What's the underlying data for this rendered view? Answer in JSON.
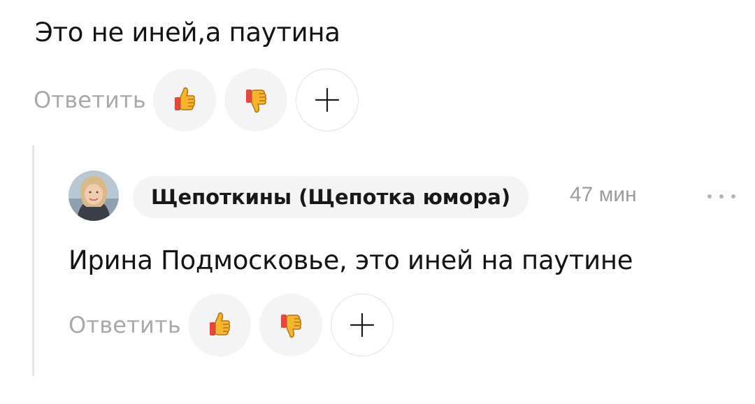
{
  "parent_comment": {
    "text": "Это не иней,а паутина",
    "reply_label": "Ответить",
    "like_icon": "thumbs-up-icon",
    "dislike_icon": "thumbs-down-icon",
    "add_reaction_icon": "plus-icon"
  },
  "reply_comment": {
    "author": "Щепоткины (Щепотка юмора)",
    "time": "47 мин",
    "text": "Ирина Подмосковье, это иней на паутине",
    "reply_label": "Ответить",
    "avatar_icon": "user-avatar",
    "more_icon": "more-dots-icon",
    "like_icon": "thumbs-up-icon",
    "dislike_icon": "thumbs-down-icon",
    "add_reaction_icon": "plus-icon"
  },
  "colors": {
    "text": "#141414",
    "muted": "#a9a9a9",
    "chip_background": "#f4f4f4",
    "thread_line": "#e5e5e5",
    "emoji_yellow": "#f7b52c",
    "emoji_red": "#e8453c"
  }
}
